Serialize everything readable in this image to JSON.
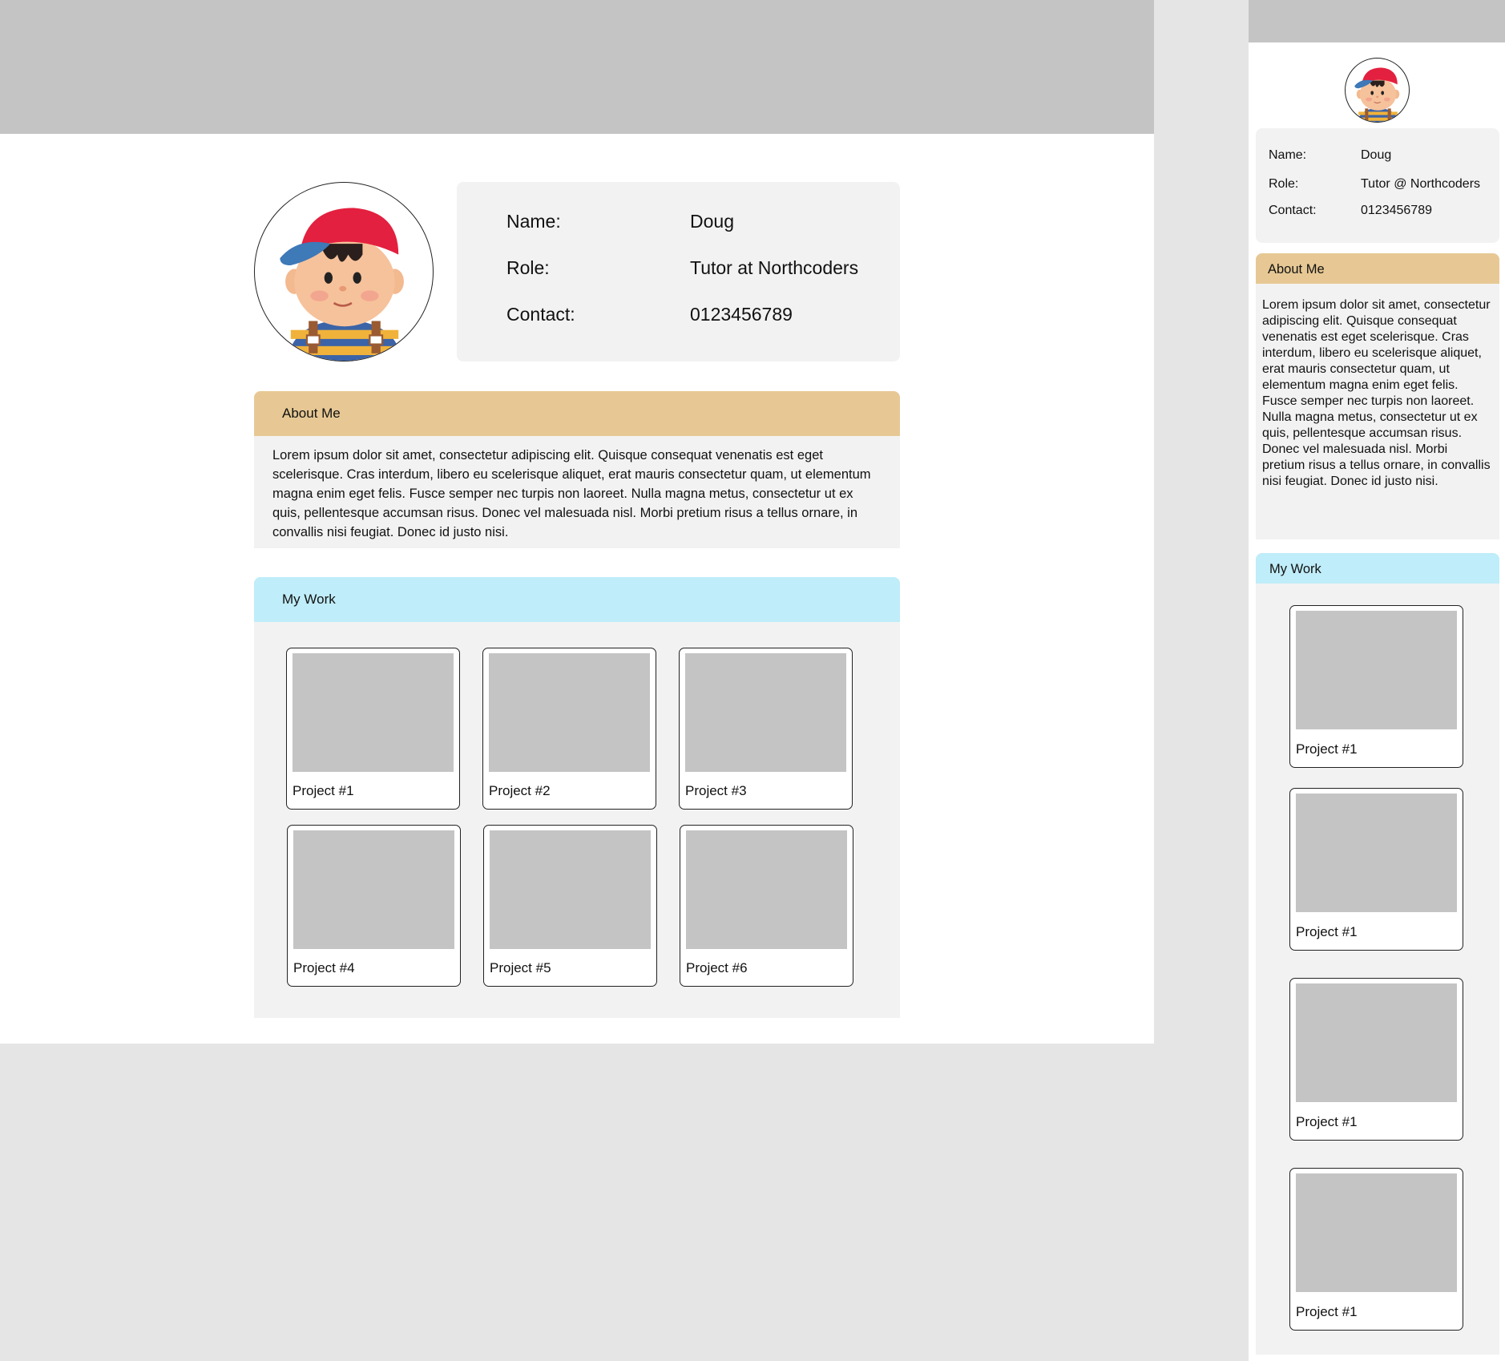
{
  "desktop": {
    "profile": {
      "name_label": "Name:",
      "name_value": "Doug",
      "role_label": "Role:",
      "role_value": "Tutor at Northcoders",
      "contact_label": "Contact:",
      "contact_value": "0123456789"
    },
    "about": {
      "title": "About Me",
      "text": "Lorem ipsum dolor sit amet, consectetur adipiscing elit. Quisque consequat venenatis est eget scelerisque. Cras interdum, libero eu scelerisque aliquet, erat mauris consectetur quam, ut elementum magna enim eget felis. Fusce semper nec turpis non laoreet. Nulla magna metus, consectetur ut ex quis, pellentesque accumsan risus. Donec vel malesuada nisl. Morbi pretium risus a tellus ornare, in convallis nisi feugiat. Donec id justo nisi."
    },
    "work": {
      "title": "My Work",
      "projects": [
        "Project #1",
        "Project #2",
        "Project #3",
        "Project #4",
        "Project #5",
        "Project #6"
      ]
    }
  },
  "mobile": {
    "profile": {
      "name_label": "Name:",
      "name_value": "Doug",
      "role_label": "Role:",
      "role_value": "Tutor @ Northcoders",
      "contact_label": "Contact:",
      "contact_value": "0123456789"
    },
    "about": {
      "title": "About Me",
      "text": "Lorem ipsum dolor sit amet, consectetur adipiscing elit. Quisque consequat venenatis est eget scelerisque. Cras interdum, libero eu scelerisque aliquet, erat mauris consectetur quam, ut elementum magna enim eget felis. Fusce semper nec turpis non laoreet. Nulla magna metus, consectetur ut ex quis, pellentesque accumsan risus. Donec vel malesuada nisl. Morbi pretium risus a tellus ornare, in convallis nisi feugiat. Donec id justo nisi."
    },
    "work": {
      "title": "My Work",
      "projects": [
        "Project #1",
        "Project #1",
        "Project #1",
        "Project #1"
      ]
    }
  },
  "colors": {
    "header_bar": "#c4c4c4",
    "about_bar": "#e7c894",
    "work_bar": "#bfedf9",
    "panel": "#f2f2f2",
    "thumbnail": "#c4c4c4"
  },
  "icons": {
    "avatar": "cartoon-boy-red-cap-avatar"
  }
}
